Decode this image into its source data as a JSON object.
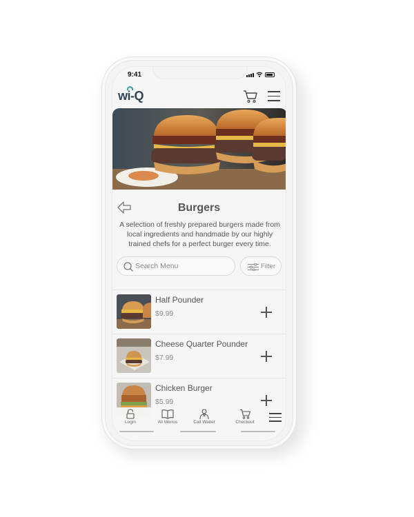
{
  "status_bar": {
    "time": "9:41"
  },
  "brand": {
    "logo_text": "wi-Q",
    "accent": "#36a3a3",
    "dark": "#2f4652"
  },
  "header": {
    "cart_icon": "cart-icon",
    "menu_icon": "hamburger-menu-icon"
  },
  "category": {
    "title": "Burgers",
    "description": "A selection of freshly prepared burgers made from local ingredients and handmade by our highly trained chefs for a perfect burger every time."
  },
  "search": {
    "placeholder": "Search Menu",
    "filter_label": "Filter"
  },
  "menu_items": [
    {
      "name": "Half Pounder",
      "price": "$9.99"
    },
    {
      "name": "Cheese Quarter Pounder",
      "price": "$7.99"
    },
    {
      "name": "Chicken Burger",
      "price": "$5.99"
    }
  ],
  "bottom_nav": {
    "items": [
      {
        "label": "Login",
        "icon": "lock-icon"
      },
      {
        "label": "All Menus",
        "icon": "book-icon"
      },
      {
        "label": "Call Waiter",
        "icon": "waiter-icon"
      },
      {
        "label": "Checkout",
        "icon": "cart-icon"
      }
    ]
  }
}
